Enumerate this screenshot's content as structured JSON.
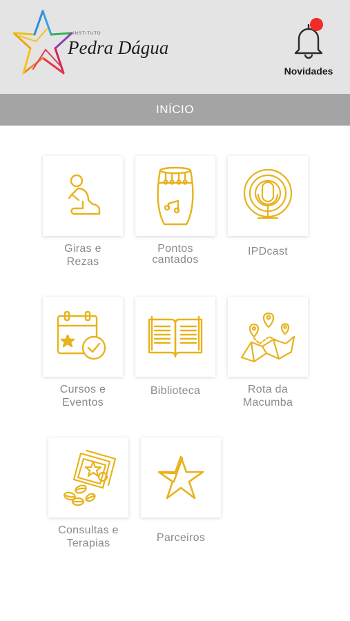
{
  "header": {
    "logo": {
      "small_text": "INSTITUTO",
      "name": "Pedra Dágua"
    },
    "notifications": {
      "label": "Novidades",
      "badge_color": "#f12a2a"
    }
  },
  "page": {
    "title": "INÍCIO"
  },
  "colors": {
    "header_bg": "#e4e4e4",
    "titlebar_bg": "#a4a4a4",
    "icon_gold": "#e8b21b",
    "label_gray": "#8a8a8a"
  },
  "menu": {
    "items": [
      {
        "label": "Giras e\nRezas",
        "icon": "praying-person-icon"
      },
      {
        "label": "Pontos\ncantados",
        "icon": "drum-icon"
      },
      {
        "label": "IPDcast",
        "icon": "podcast-microphone-icon"
      },
      {
        "label": "Cursos e\nEventos",
        "icon": "calendar-star-check-icon"
      },
      {
        "label": "Biblioteca",
        "icon": "open-book-icon"
      },
      {
        "label": "Rota da\nMacumba",
        "icon": "map-pins-icon"
      },
      {
        "label": "Consultas e\nTerapias",
        "icon": "cards-shells-icon"
      },
      {
        "label": "Parceiros",
        "icon": "star-icon"
      }
    ]
  }
}
